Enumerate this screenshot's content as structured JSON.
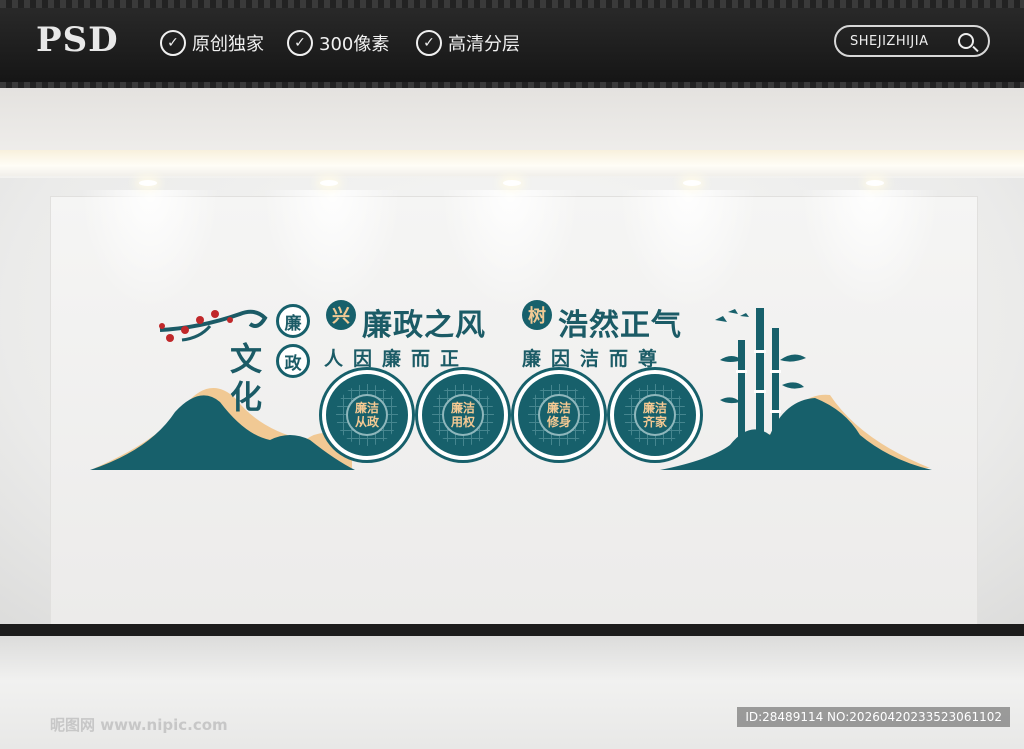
{
  "header": {
    "logo": "PSD",
    "features": [
      "原创独家",
      "300像素",
      "高清分层"
    ],
    "search_label": "SHEJIZHIJIA"
  },
  "wall": {
    "vertical_badges": [
      "廉",
      "政"
    ],
    "vertical_title": [
      "文",
      "化"
    ],
    "slogan_left_badge": "兴",
    "slogan_left": "廉政之风",
    "slogan_right_badge": "树",
    "slogan_right": "浩然正气",
    "subline_left": "人因廉而正",
    "subline_right": "廉因洁而尊",
    "medals": [
      {
        "top": "廉洁",
        "bottom": "从政"
      },
      {
        "top": "廉洁",
        "bottom": "用权"
      },
      {
        "top": "廉洁",
        "bottom": "修身"
      },
      {
        "top": "廉洁",
        "bottom": "齐家"
      }
    ],
    "colors": {
      "primary": "#17606b",
      "accent": "#f1c994",
      "blossom": "#c0282a"
    }
  },
  "watermark": {
    "site": "昵图网 www.nipic.com",
    "id_text": "ID:28489114 NO:20260420233523061102"
  }
}
